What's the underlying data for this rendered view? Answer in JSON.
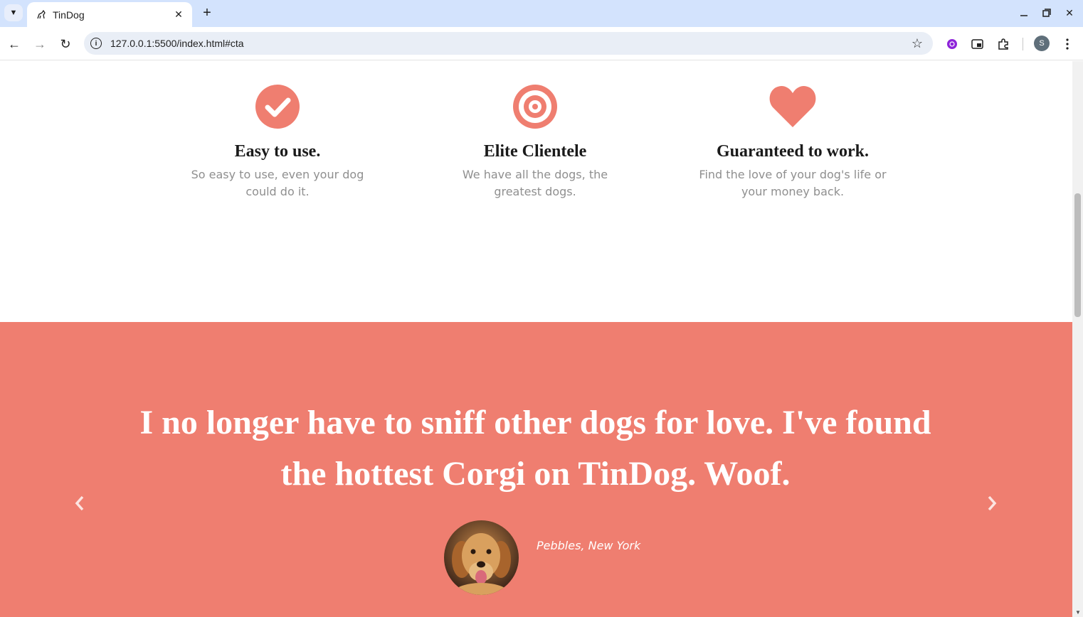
{
  "browser": {
    "tab_title": "TinDog",
    "url": "127.0.0.1:5500/index.html#cta",
    "profile_initial": "S",
    "icons": [
      "tab-search-icon",
      "tindog-favicon-icon",
      "close-icon",
      "plus-icon",
      "minimize-icon",
      "restore-icon",
      "window-close-icon",
      "back-icon",
      "forward-icon",
      "reload-icon",
      "info-icon",
      "star-icon",
      "extension-purple-icon",
      "picture-in-picture-icon",
      "puzzle-icon",
      "more-vert-icon"
    ]
  },
  "features": [
    {
      "icon": "check-circle-icon",
      "title": "Easy to use.",
      "text": "So easy to use, even your dog could do it."
    },
    {
      "icon": "bullseye-icon",
      "title": "Elite Clientele",
      "text": "We have all the dogs, the greatest dogs."
    },
    {
      "icon": "heart-icon",
      "title": "Guaranteed to work.",
      "text": "Find the love of your dog's life or your money back."
    }
  ],
  "testimonial": {
    "quote": "I no longer have to sniff other dogs for love. I've found the hottest Corgi on TinDog. Woof.",
    "author": "Pebbles, New York",
    "avatar_icon": "dog-avatar-icon"
  },
  "colors": {
    "accent": "#ef7e70",
    "browser_tabstrip": "#d3e3fd",
    "feature_text": "#8f8f8f"
  }
}
